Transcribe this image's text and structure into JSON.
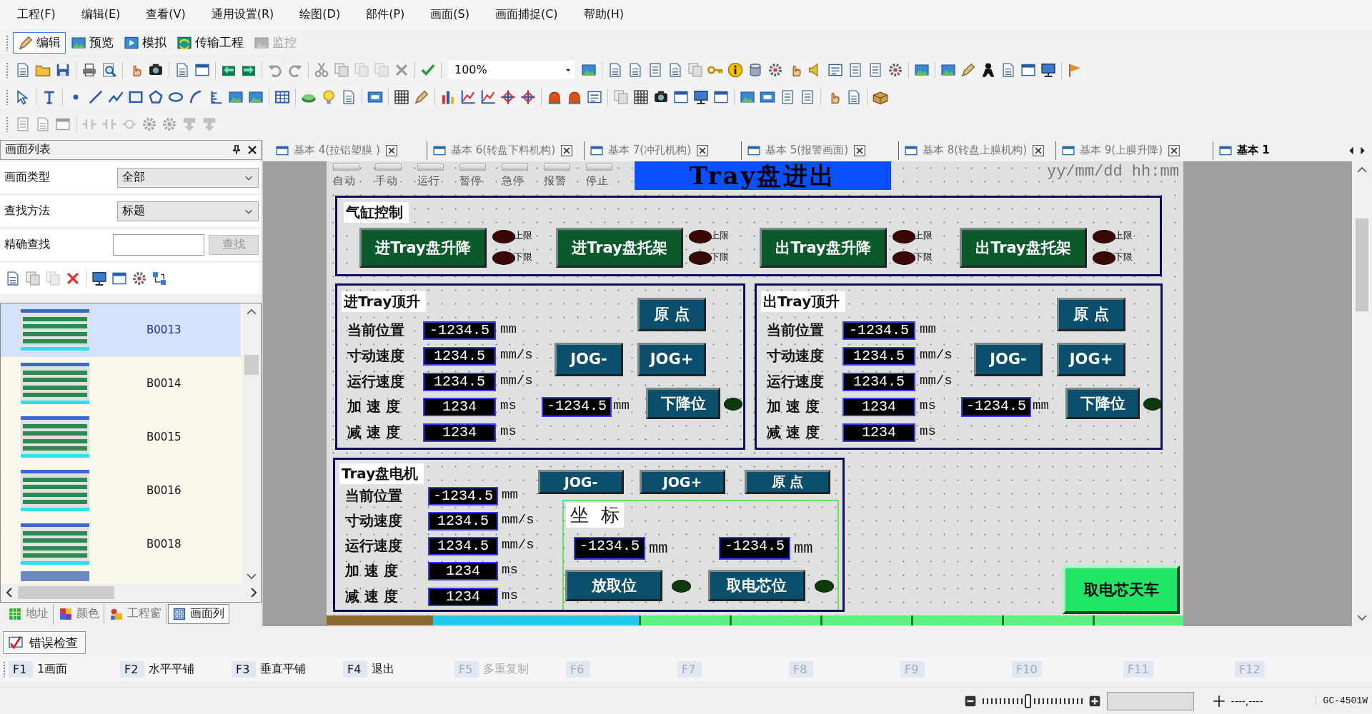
{
  "menu": [
    "工程(F)",
    "编辑(E)",
    "查看(V)",
    "通用设置(R)",
    "绘图(D)",
    "部件(P)",
    "画面(S)",
    "画面捕捉(C)",
    "帮助(H)"
  ],
  "mode_toolbar": [
    {
      "label": "编辑",
      "selected": true,
      "disabled": false
    },
    {
      "label": "预览",
      "selected": false,
      "disabled": false
    },
    {
      "label": "模拟",
      "selected": false,
      "disabled": false
    },
    {
      "label": "传输工程",
      "selected": false,
      "disabled": false
    },
    {
      "label": "监控",
      "selected": false,
      "disabled": true
    }
  ],
  "zoom_combo": {
    "value": "100%"
  },
  "screen_list_panel": {
    "title": "画面列表",
    "filters": [
      {
        "kind": "dropdown",
        "label": "画面类型",
        "value": "全部"
      },
      {
        "kind": "dropdown",
        "label": "查找方法",
        "value": "标题"
      },
      {
        "kind": "search",
        "label": "精确查找",
        "button": {
          "label": "查找",
          "disabled": true
        }
      }
    ],
    "items": [
      {
        "name": "B0013",
        "selected": true
      },
      {
        "name": "B0014",
        "selected": false
      },
      {
        "name": "B0015",
        "selected": false
      },
      {
        "name": "B0016",
        "selected": false
      },
      {
        "name": "B0018",
        "selected": false
      }
    ],
    "bottom_tabs": [
      {
        "label": "地址",
        "selected": false
      },
      {
        "label": "颜色",
        "selected": false
      },
      {
        "label": "工程窗",
        "selected": false
      },
      {
        "label": "画面列",
        "selected": true
      }
    ]
  },
  "document_tabs": [
    {
      "label": "基本 4(拉铝塑膜 )",
      "selected": false
    },
    {
      "label": "基本 6(转盘下料机构)",
      "selected": false
    },
    {
      "label": "基本 7(冲孔机构)",
      "selected": false
    },
    {
      "label": "基本 5(报警画面)",
      "selected": false
    },
    {
      "label": "基本 8(转盘上膜机构)",
      "selected": false
    },
    {
      "label": "基本 9(上膜升降)",
      "selected": false
    },
    {
      "label": "基本 1",
      "selected": true
    }
  ],
  "hmi_screen": {
    "status_lamps": [
      "自动",
      "手动",
      "运行",
      "暂停",
      "急停",
      "报警",
      "停止"
    ],
    "title": "Tray盘进出",
    "datetime": "yy/mm/dd hh:mm",
    "cylinder_panel": {
      "title": "气缸控制",
      "buttons": [
        {
          "label": "进Tray盘升降",
          "upper": "上限",
          "lower": "下限"
        },
        {
          "label": "进Tray盘托架",
          "upper": "上限",
          "lower": "下限"
        },
        {
          "label": "出Tray盘升降",
          "upper": "上限",
          "lower": "下限"
        },
        {
          "label": "出Tray盘托架",
          "upper": "上限",
          "lower": "下限"
        }
      ]
    },
    "lift_panels": [
      {
        "title": "进Tray顶升",
        "rows": [
          {
            "label": "当前位置",
            "value": "-1234.5",
            "unit": "mm"
          },
          {
            "label": "寸动速度",
            "value": "1234.5",
            "unit": "mm/s"
          },
          {
            "label": "运行速度",
            "value": "1234.5",
            "unit": "mm/s"
          },
          {
            "label": "加 速 度",
            "value": "1234",
            "unit": "ms"
          },
          {
            "label": "减 速 度",
            "value": "1234",
            "unit": "ms"
          }
        ],
        "buttons": [
          {
            "kind": "home",
            "label": "原 点"
          },
          {
            "kind": "jog_minus",
            "label": "JOG-"
          },
          {
            "kind": "jog_plus",
            "label": "JOG+"
          },
          {
            "kind": "down",
            "label": "下降位"
          }
        ],
        "position": {
          "value": "-1234.5",
          "unit": "mm"
        }
      },
      {
        "title": "出Tray顶升",
        "rows": [
          {
            "label": "当前位置",
            "value": "-1234.5",
            "unit": "mm"
          },
          {
            "label": "寸动速度",
            "value": "1234.5",
            "unit": "mm/s"
          },
          {
            "label": "运行速度",
            "value": "1234.5",
            "unit": "mm/s"
          },
          {
            "label": "加 速 度",
            "value": "1234",
            "unit": "ms"
          },
          {
            "label": "减 速 度",
            "value": "1234",
            "unit": "ms"
          }
        ],
        "buttons": [
          {
            "kind": "home",
            "label": "原 点"
          },
          {
            "kind": "jog_minus",
            "label": "JOG-"
          },
          {
            "kind": "jog_plus",
            "label": "JOG+"
          },
          {
            "kind": "down",
            "label": "下降位"
          }
        ],
        "position": {
          "value": "-1234.5",
          "unit": "mm"
        }
      }
    ],
    "motor_panel": {
      "title": "Tray盘电机",
      "rows": [
        {
          "label": "当前位置",
          "value": "-1234.5",
          "unit": "mm"
        },
        {
          "label": "寸动速度",
          "value": "1234.5",
          "unit": "mm/s"
        },
        {
          "label": "运行速度",
          "value": "1234.5",
          "unit": "mm/s"
        },
        {
          "label": "加 速 度",
          "value": "1234",
          "unit": "ms"
        },
        {
          "label": "减 速 度",
          "value": "1234",
          "unit": "ms"
        }
      ],
      "buttons": [
        {
          "kind": "jog_minus",
          "label": "JOG-"
        },
        {
          "kind": "jog_plus",
          "label": "JOG+"
        },
        {
          "kind": "home",
          "label": "原 点"
        }
      ],
      "coordinates": {
        "title": "坐  标",
        "positions": [
          {
            "value": "-1234.5",
            "unit": "mm",
            "button": "放取位"
          },
          {
            "value": "-1234.5",
            "unit": "mm",
            "button": "取电芯位"
          }
        ]
      }
    },
    "crane_button": "取电芯天车"
  },
  "error_check_tab": "错误检查",
  "fkeys": [
    {
      "key": "F1",
      "label": "1画面",
      "disabled": false
    },
    {
      "key": "F2",
      "label": "水平平铺",
      "disabled": false
    },
    {
      "key": "F3",
      "label": "垂直平铺",
      "disabled": false
    },
    {
      "key": "F4",
      "label": "退出",
      "disabled": false
    },
    {
      "key": "F5",
      "label": "多重复制",
      "disabled": true
    },
    {
      "key": "F6",
      "disabled": true
    },
    {
      "key": "F7",
      "disabled": true
    },
    {
      "key": "F8",
      "disabled": true
    },
    {
      "key": "F9",
      "disabled": true
    },
    {
      "key": "F10",
      "disabled": true
    },
    {
      "key": "F11",
      "disabled": true
    },
    {
      "key": "F12",
      "disabled": true
    }
  ],
  "status_bar": {
    "zoom_slider": {
      "level": 0.45
    },
    "coordinates": "----,----",
    "model": "GC-4501W"
  }
}
